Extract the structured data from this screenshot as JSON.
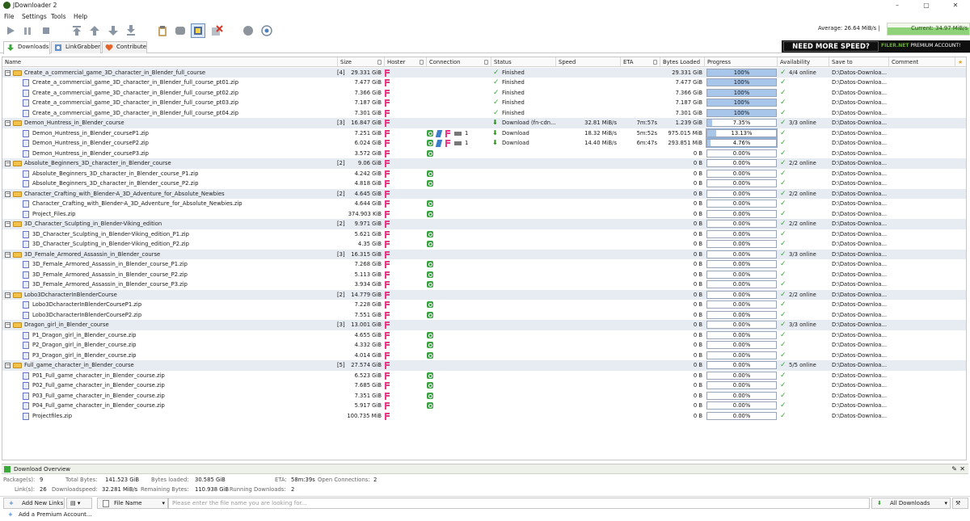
{
  "window": {
    "title": "JDownloader 2",
    "controls": [
      "–",
      "▢",
      "✕"
    ]
  },
  "menu": [
    "File",
    "Settings",
    "Tools",
    "Help"
  ],
  "speed": {
    "average": "Average: 26.64 MiB/s |",
    "current": "Current: 34.97 MiB/s"
  },
  "tabs": [
    {
      "label": "Downloads",
      "active": true
    },
    {
      "label": "LinkGrabber",
      "active": false
    },
    {
      "label": "Contribute",
      "active": false
    }
  ],
  "banner": {
    "need": "NEED MORE SPEED?",
    "brand_green": "FILER.NET",
    "brand_rest": " PREMIUM ACCOUNT!"
  },
  "columns": [
    "Name",
    "Size",
    "Hoster",
    "Connection",
    "Status",
    "Speed",
    "ETA",
    "Bytes Loaded",
    "Progress",
    "Availability",
    "Save to",
    "Comment"
  ],
  "rows": [
    {
      "type": "pkg",
      "name": "Create_a_commercial_game_3D_character_in_Blender_full_course",
      "count": "[4]",
      "size": "29.331 GiB",
      "status": "Finished",
      "status_icon": "check",
      "bytes": "29.331 GiB",
      "progress": "100%",
      "progress_value": 100,
      "availability": "4/4 online",
      "save": "D:\\Datos-Downloa..."
    },
    {
      "type": "file",
      "name": "Create_a_commercial_game_3D_character_in_Blender_full_course_pt01.zip",
      "size": "7.477 GiB",
      "status": "Finished",
      "status_icon": "check",
      "bytes": "7.477 GiB",
      "progress": "100%",
      "progress_value": 100,
      "save": "D:\\Datos-Downloa..."
    },
    {
      "type": "file",
      "name": "Create_a_commercial_game_3D_character_in_Blender_full_course_pt02.zip",
      "size": "7.366 GiB",
      "status": "Finished",
      "status_icon": "check",
      "bytes": "7.366 GiB",
      "progress": "100%",
      "progress_value": 100,
      "save": "D:\\Datos-Downloa..."
    },
    {
      "type": "file",
      "name": "Create_a_commercial_game_3D_character_in_Blender_full_course_pt03.zip",
      "size": "7.187 GiB",
      "status": "Finished",
      "status_icon": "check",
      "bytes": "7.187 GiB",
      "progress": "100%",
      "progress_value": 100,
      "save": "D:\\Datos-Downloa..."
    },
    {
      "type": "file",
      "name": "Create_a_commercial_game_3D_character_in_Blender_full_course_pt04.zip",
      "size": "7.301 GiB",
      "status": "Finished",
      "status_icon": "check",
      "bytes": "7.301 GiB",
      "progress": "100%",
      "progress_value": 100,
      "save": "D:\\Datos-Downloa..."
    },
    {
      "type": "pkg",
      "name": "Demon_Huntress_in_Blender_course",
      "count": "[3]",
      "size": "16.847 GiB",
      "status": "Download (fn-cdn...",
      "status_icon": "download",
      "speed": "32.81 MiB/s",
      "eta": "7m:57s",
      "bytes": "1.239 GiB",
      "progress": "7.35%",
      "progress_value": 7.35,
      "availability": "3/3 online",
      "save": "D:\\Datos-Downloa..."
    },
    {
      "type": "file",
      "name": "Demon_Huntress_in_Blender_courseP1.zip",
      "size": "7.251 GiB",
      "conn": "1",
      "status": "Download",
      "status_icon": "download",
      "speed": "18.32 MiB/s",
      "eta": "5m:52s",
      "bytes": "975.015 MiB",
      "progress": "13.13%",
      "progress_value": 13.13,
      "save": "D:\\Datos-Downloa...",
      "selected": true
    },
    {
      "type": "file",
      "name": "Demon_Huntress_in_Blender_courseP2.zip",
      "size": "6.024 GiB",
      "conn": "1",
      "status": "Download",
      "status_icon": "download",
      "speed": "14.40 MiB/s",
      "eta": "6m:47s",
      "bytes": "293.851 MiB",
      "progress": "4.76%",
      "progress_value": 4.76,
      "save": "D:\\Datos-Downloa...",
      "selected": true
    },
    {
      "type": "file",
      "name": "Demon_Huntress_in_Blender_courseP3.zip",
      "size": "3.572 GiB",
      "bytes": "0 B",
      "progress": "0.00%",
      "progress_value": 0,
      "save": "D:\\Datos-Downloa...",
      "recycle": true
    },
    {
      "type": "pkg",
      "name": "Absolute_Beginners_3D_character_in_Blender_course",
      "count": "[2]",
      "size": "9.06 GiB",
      "bytes": "0 B",
      "progress": "0.00%",
      "progress_value": 0,
      "availability": "2/2 online",
      "save": "D:\\Datos-Downloa..."
    },
    {
      "type": "file",
      "name": "Absolute_Beginners_3D_character_in_Blender_course_P1.zip",
      "size": "4.242 GiB",
      "bytes": "0 B",
      "progress": "0.00%",
      "progress_value": 0,
      "save": "D:\\Datos-Downloa...",
      "recycle": true
    },
    {
      "type": "file",
      "name": "Absolute_Beginners_3D_character_in_Blender_course_P2.zip",
      "size": "4.818 GiB",
      "bytes": "0 B",
      "progress": "0.00%",
      "progress_value": 0,
      "save": "D:\\Datos-Downloa...",
      "recycle": true
    },
    {
      "type": "pkg",
      "name": "Character_Crafting_with_Blender-A_3D_Adventure_for_Absolute_Newbies",
      "count": "[2]",
      "size": "4.645 GiB",
      "bytes": "0 B",
      "progress": "0.00%",
      "progress_value": 0,
      "availability": "2/2 online",
      "save": "D:\\Datos-Downloa..."
    },
    {
      "type": "file",
      "name": "Character_Crafting_with_Blender-A_3D_Adventure_for_Absolute_Newbies.zip",
      "size": "4.644 GiB",
      "bytes": "0 B",
      "progress": "0.00%",
      "progress_value": 0,
      "save": "D:\\Datos-Downloa...",
      "recycle": true
    },
    {
      "type": "file",
      "name": "Project_Files.zip",
      "size": "374.903 KiB",
      "bytes": "0 B",
      "progress": "0.00%",
      "progress_value": 0,
      "save": "D:\\Datos-Downloa...",
      "recycle": true
    },
    {
      "type": "pkg",
      "name": "3D_Character_Sculpting_in_Blender-Viking_edition",
      "count": "[2]",
      "size": "9.971 GiB",
      "bytes": "0 B",
      "progress": "0.00%",
      "progress_value": 0,
      "availability": "2/2 online",
      "save": "D:\\Datos-Downloa..."
    },
    {
      "type": "file",
      "name": "3D_Character_Sculpting_in_Blender-Viking_edition_P1.zip",
      "size": "5.621 GiB",
      "bytes": "0 B",
      "progress": "0.00%",
      "progress_value": 0,
      "save": "D:\\Datos-Downloa...",
      "recycle": true
    },
    {
      "type": "file",
      "name": "3D_Character_Sculpting_in_Blender-Viking_edition_P2.zip",
      "size": "4.35 GiB",
      "bytes": "0 B",
      "progress": "0.00%",
      "progress_value": 0,
      "save": "D:\\Datos-Downloa...",
      "recycle": true
    },
    {
      "type": "pkg",
      "name": "3D_Female_Armored_Assassin_in_Blender_course",
      "count": "[3]",
      "size": "16.315 GiB",
      "bytes": "0 B",
      "progress": "0.00%",
      "progress_value": 0,
      "availability": "3/3 online",
      "save": "D:\\Datos-Downloa..."
    },
    {
      "type": "file",
      "name": "3D_Female_Armored_Assassin_in_Blender_course_P1.zip",
      "size": "7.268 GiB",
      "bytes": "0 B",
      "progress": "0.00%",
      "progress_value": 0,
      "save": "D:\\Datos-Downloa...",
      "recycle": true
    },
    {
      "type": "file",
      "name": "3D_Female_Armored_Assassin_in_Blender_course_P2.zip",
      "size": "5.113 GiB",
      "bytes": "0 B",
      "progress": "0.00%",
      "progress_value": 0,
      "save": "D:\\Datos-Downloa...",
      "recycle": true
    },
    {
      "type": "file",
      "name": "3D_Female_Armored_Assassin_in_Blender_course_P3.zip",
      "size": "3.934 GiB",
      "bytes": "0 B",
      "progress": "0.00%",
      "progress_value": 0,
      "save": "D:\\Datos-Downloa...",
      "recycle": true
    },
    {
      "type": "pkg",
      "name": "Lobo3DcharacterInBlenderCourse",
      "count": "[2]",
      "size": "14.779 GiB",
      "bytes": "0 B",
      "progress": "0.00%",
      "progress_value": 0,
      "availability": "2/2 online",
      "save": "D:\\Datos-Downloa..."
    },
    {
      "type": "file",
      "name": "Lobo3DcharacterInBlenderCourseP1.zip",
      "size": "7.228 GiB",
      "bytes": "0 B",
      "progress": "0.00%",
      "progress_value": 0,
      "save": "D:\\Datos-Downloa...",
      "recycle": true
    },
    {
      "type": "file",
      "name": "Lobo3DcharacterInBlenderCourseP2.zip",
      "size": "7.551 GiB",
      "bytes": "0 B",
      "progress": "0.00%",
      "progress_value": 0,
      "save": "D:\\Datos-Downloa...",
      "recycle": true
    },
    {
      "type": "pkg",
      "name": "Dragon_girl_in_Blender_course",
      "count": "[3]",
      "size": "13.001 GiB",
      "bytes": "0 B",
      "progress": "0.00%",
      "progress_value": 0,
      "availability": "3/3 online",
      "save": "D:\\Datos-Downloa..."
    },
    {
      "type": "file",
      "name": "P1_Dragon_girl_in_Blender_course.zip",
      "size": "4.655 GiB",
      "bytes": "0 B",
      "progress": "0.00%",
      "progress_value": 0,
      "save": "D:\\Datos-Downloa...",
      "recycle": true
    },
    {
      "type": "file",
      "name": "P2_Dragon_girl_in_Blender_course.zip",
      "size": "4.332 GiB",
      "bytes": "0 B",
      "progress": "0.00%",
      "progress_value": 0,
      "save": "D:\\Datos-Downloa...",
      "recycle": true
    },
    {
      "type": "file",
      "name": "P3_Dragon_girl_in_Blender_course.zip",
      "size": "4.014 GiB",
      "bytes": "0 B",
      "progress": "0.00%",
      "progress_value": 0,
      "save": "D:\\Datos-Downloa...",
      "recycle": true
    },
    {
      "type": "pkg",
      "name": "Full_game_character_in_Blender_course",
      "count": "[5]",
      "size": "27.574 GiB",
      "bytes": "0 B",
      "progress": "0.00%",
      "progress_value": 0,
      "availability": "5/5 online",
      "save": "D:\\Datos-Downloa..."
    },
    {
      "type": "file",
      "name": "P01_Full_game_character_in_Blender_course.zip",
      "size": "6.523 GiB",
      "bytes": "0 B",
      "progress": "0.00%",
      "progress_value": 0,
      "save": "D:\\Datos-Downloa...",
      "recycle": true
    },
    {
      "type": "file",
      "name": "P02_Full_game_character_in_Blender_course.zip",
      "size": "7.685 GiB",
      "bytes": "0 B",
      "progress": "0.00%",
      "progress_value": 0,
      "save": "D:\\Datos-Downloa...",
      "recycle": true
    },
    {
      "type": "file",
      "name": "P03_Full_game_character_in_Blender_course.zip",
      "size": "7.351 GiB",
      "bytes": "0 B",
      "progress": "0.00%",
      "progress_value": 0,
      "save": "D:\\Datos-Downloa...",
      "recycle": true
    },
    {
      "type": "file",
      "name": "P04_Full_game_character_in_Blender_course.zip",
      "size": "5.917 GiB",
      "bytes": "0 B",
      "progress": "0.00%",
      "progress_value": 0,
      "save": "D:\\Datos-Downloa...",
      "recycle": true
    },
    {
      "type": "file",
      "name": "Projectfiles.zip",
      "size": "100.735 MiB",
      "bytes": "0 B",
      "progress": "0.00%",
      "progress_value": 0,
      "save": "D:\\Datos-Downloa..."
    }
  ],
  "overview": {
    "title": "Download Overview",
    "line1": [
      {
        "label": "Package(s):",
        "value": "9"
      },
      {
        "label": "Total Bytes:",
        "value": "141.523 GiB"
      },
      {
        "label": "Bytes loaded:",
        "value": "30.585 GiB"
      },
      {
        "label": "ETA:",
        "value": "58m:39s"
      },
      {
        "label": "Open Connections:",
        "value": "2"
      }
    ],
    "line2": [
      {
        "label": "Link(s):",
        "value": "26"
      },
      {
        "label": "Downloadspeed:",
        "value": "32.281 MiB/s"
      },
      {
        "label": "Remaining Bytes:",
        "value": "110.938 GiB"
      },
      {
        "label": "Running Downloads:",
        "value": "2"
      }
    ]
  },
  "bottom": {
    "add_links": "Add New Links",
    "file_name": "File Name",
    "search_placeholder": "Please enter the file name you are looking for...",
    "all_downloads": "All Downloads",
    "premium": "Add a Premium Account..."
  },
  "colors": {
    "accent_green": "#3aa83a",
    "pkg_row": "#e7ecf3",
    "progress_fill": "#a7c6ea",
    "hoster_pink": "#e6398a"
  }
}
